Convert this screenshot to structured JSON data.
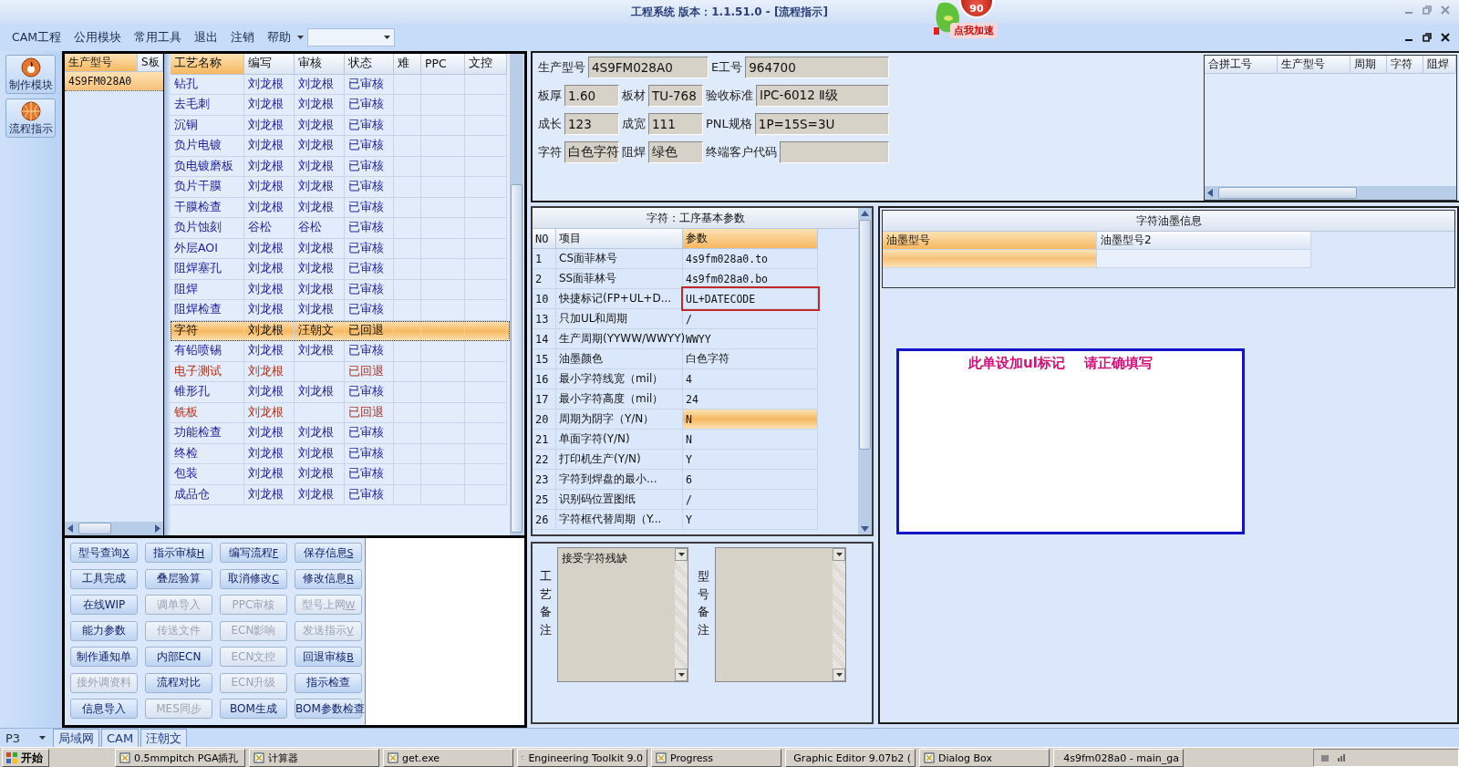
{
  "window": {
    "title": "工程系统   版本：1.1.51.0 - [流程指示]"
  },
  "speed_badge": {
    "value": "90",
    "label": "点我加速"
  },
  "menu": [
    "CAM工程",
    "公用模块",
    "常用工具",
    "退出",
    "注销",
    "帮助"
  ],
  "nav_buttons": [
    "制作模块",
    "流程指示"
  ],
  "model_list": {
    "columns": [
      "生产型号",
      "S板"
    ],
    "rows": [
      {
        "model": "4S9FM028A0",
        "selected": true
      }
    ]
  },
  "process_table": {
    "columns": [
      "工艺名称",
      "编写",
      "审核",
      "状态",
      "难",
      "PPC",
      "文控"
    ],
    "rows": [
      {
        "cells": [
          "钻孔",
          "刘龙根",
          "刘龙根",
          "已审核"
        ],
        "alert": false,
        "selected": false
      },
      {
        "cells": [
          "去毛刺",
          "刘龙根",
          "刘龙根",
          "已审核"
        ],
        "alert": false,
        "selected": false
      },
      {
        "cells": [
          "沉铜",
          "刘龙根",
          "刘龙根",
          "已审核"
        ],
        "alert": false,
        "selected": false
      },
      {
        "cells": [
          "负片电镀",
          "刘龙根",
          "刘龙根",
          "已审核"
        ],
        "alert": false,
        "selected": false
      },
      {
        "cells": [
          "负电镀磨板",
          "刘龙根",
          "刘龙根",
          "已审核"
        ],
        "alert": false,
        "selected": false
      },
      {
        "cells": [
          "负片干膜",
          "刘龙根",
          "刘龙根",
          "已审核"
        ],
        "alert": false,
        "selected": false
      },
      {
        "cells": [
          "干膜检查",
          "刘龙根",
          "刘龙根",
          "已审核"
        ],
        "alert": false,
        "selected": false
      },
      {
        "cells": [
          "负片蚀刻",
          "谷松",
          "谷松",
          "已审核"
        ],
        "alert": false,
        "selected": false
      },
      {
        "cells": [
          "外层AOI",
          "刘龙根",
          "刘龙根",
          "已审核"
        ],
        "alert": false,
        "selected": false
      },
      {
        "cells": [
          "阻焊塞孔",
          "刘龙根",
          "刘龙根",
          "已审核"
        ],
        "alert": false,
        "selected": false
      },
      {
        "cells": [
          "阻焊",
          "刘龙根",
          "刘龙根",
          "已审核"
        ],
        "alert": false,
        "selected": false
      },
      {
        "cells": [
          "阻焊检查",
          "刘龙根",
          "刘龙根",
          "已审核"
        ],
        "alert": false,
        "selected": false
      },
      {
        "cells": [
          "字符",
          "刘龙根",
          "汪朝文",
          "已回退"
        ],
        "alert": false,
        "selected": true
      },
      {
        "cells": [
          "有铅喷锡",
          "刘龙根",
          "刘龙根",
          "已审核"
        ],
        "alert": false,
        "selected": false
      },
      {
        "cells": [
          "电子测试",
          "刘龙根",
          "",
          "已回退"
        ],
        "alert": true,
        "selected": false
      },
      {
        "cells": [
          "锥形孔",
          "刘龙根",
          "刘龙根",
          "已审核"
        ],
        "alert": false,
        "selected": false
      },
      {
        "cells": [
          "铣板",
          "刘龙根",
          "",
          "已回退"
        ],
        "alert": true,
        "selected": false
      },
      {
        "cells": [
          "功能检查",
          "刘龙根",
          "刘龙根",
          "已审核"
        ],
        "alert": false,
        "selected": false
      },
      {
        "cells": [
          "终检",
          "刘龙根",
          "刘龙根",
          "已审核"
        ],
        "alert": false,
        "selected": false
      },
      {
        "cells": [
          "包装",
          "刘龙根",
          "刘龙根",
          "已审核"
        ],
        "alert": false,
        "selected": false
      },
      {
        "cells": [
          "成品仓",
          "刘龙根",
          "刘龙根",
          "已审核"
        ],
        "alert": false,
        "selected": false
      }
    ]
  },
  "actions": [
    {
      "label": "型号查询",
      "hotkey": "X",
      "disabled": false
    },
    {
      "label": "指示审核",
      "hotkey": "H",
      "disabled": false
    },
    {
      "label": "编写流程",
      "hotkey": "F",
      "disabled": false
    },
    {
      "label": "保存信息",
      "hotkey": "S",
      "disabled": false
    },
    {
      "label": "工具完成",
      "disabled": false
    },
    {
      "label": "叠层验算",
      "disabled": false
    },
    {
      "label": "取消修改",
      "hotkey": "C",
      "disabled": false
    },
    {
      "label": "修改信息",
      "hotkey": "R",
      "disabled": false
    },
    {
      "label": "在线WIP",
      "disabled": false
    },
    {
      "label": "调单导入",
      "disabled": true
    },
    {
      "label": "PPC审核",
      "disabled": true
    },
    {
      "label": "型号上网",
      "hotkey": "W",
      "disabled": true
    },
    {
      "label": "能力参数",
      "disabled": false
    },
    {
      "label": "传送文件",
      "disabled": true
    },
    {
      "label": "ECN影响",
      "disabled": true
    },
    {
      "label": "发送指示",
      "hotkey": "V",
      "disabled": true
    },
    {
      "label": "制作通知单",
      "disabled": false
    },
    {
      "label": "内部ECN",
      "disabled": false
    },
    {
      "label": "ECN文控",
      "disabled": true
    },
    {
      "label": "回退审核",
      "hotkey": "B",
      "disabled": false
    },
    {
      "label": "接外调资料",
      "disabled": true
    },
    {
      "label": "流程对比",
      "disabled": false
    },
    {
      "label": "ECN升级",
      "disabled": true
    },
    {
      "label": "指示检查",
      "disabled": false
    },
    {
      "label": "信息导入",
      "disabled": false
    },
    {
      "label": "MES同步",
      "disabled": true
    },
    {
      "label": "BOM生成",
      "disabled": false
    },
    {
      "label": "BOM参数检查",
      "disabled": false
    }
  ],
  "info_fields": [
    [
      {
        "label": "生产型号",
        "value": "4S9FM028A0"
      },
      {
        "label": "E工号",
        "value": "964700"
      }
    ],
    [
      {
        "label": "板厚",
        "value": "1.60"
      },
      {
        "label": "板材",
        "value": "TU-768"
      },
      {
        "label": "验收标准",
        "value": "IPC-6012 Ⅱ级"
      }
    ],
    [
      {
        "label": "成长",
        "value": "123"
      },
      {
        "label": "成宽",
        "value": "111"
      },
      {
        "label": "PNL规格",
        "value": "1P=15S=3U"
      }
    ],
    [
      {
        "label": "字符",
        "value": "白色字符"
      },
      {
        "label": "阻焊",
        "value": "绿色"
      },
      {
        "label": "终端客户代码"
      }
    ]
  ],
  "batch_table": {
    "columns": [
      "合拼工号",
      "生产型号",
      "周期",
      "字符",
      "阻焊"
    ]
  },
  "params": {
    "title": "字符：工序基本参数",
    "columns": [
      "NO",
      "项目",
      "参数"
    ],
    "rows": [
      {
        "no": "1",
        "item": "CS面菲林号",
        "value": "4s9fm028a0.to",
        "selected": false,
        "marked": false
      },
      {
        "no": "2",
        "item": "SS面菲林号",
        "value": "4s9fm028a0.bo",
        "selected": false,
        "marked": false
      },
      {
        "no": "10",
        "item": "快捷标记(FP+UL+D...",
        "value": "UL+DATECODE",
        "selected": false,
        "marked": true
      },
      {
        "no": "13",
        "item": "只加UL和周期",
        "value": "/",
        "selected": false,
        "marked": false
      },
      {
        "no": "14",
        "item": "生产周期(YYWW/WWYY)",
        "value": "WWYY",
        "selected": false,
        "marked": false
      },
      {
        "no": "15",
        "item": "油墨颜色",
        "value": "白色字符",
        "selected": false,
        "marked": false
      },
      {
        "no": "16",
        "item": "最小字符线宽（mil）",
        "value": "4",
        "selected": false,
        "marked": false
      },
      {
        "no": "17",
        "item": "最小字符高度（mil）",
        "value": "24",
        "selected": false,
        "marked": false
      },
      {
        "no": "20",
        "item": "周期为阴字（Y/N）",
        "value": "N",
        "selected": true,
        "marked": false
      },
      {
        "no": "21",
        "item": "单面字符(Y/N)",
        "value": "N",
        "selected": false,
        "marked": false
      },
      {
        "no": "22",
        "item": "打印机生产(Y/N)",
        "value": "Y",
        "selected": false,
        "marked": false
      },
      {
        "no": "23",
        "item": "字符到焊盘的最小...",
        "value": "6",
        "selected": false,
        "marked": false
      },
      {
        "no": "25",
        "item": "识别码位置图纸",
        "value": "/",
        "selected": false,
        "marked": false
      },
      {
        "no": "26",
        "item": "字符框代替周期（Y...",
        "value": "Y",
        "selected": false,
        "marked": false
      }
    ]
  },
  "remarks": [
    {
      "label": "工艺备注",
      "text": "接受字符残缺"
    },
    {
      "label": "型号备注"
    }
  ],
  "ink": {
    "title": "字符油墨信息",
    "columns": [
      "油墨型号",
      "油墨型号2"
    ]
  },
  "note": "此单设加ul标记    请正确填写",
  "bottom_tabs": {
    "selector": "P3",
    "tabs": [
      "局域网",
      "CAM",
      "汪朝文"
    ]
  },
  "taskbar": {
    "start": "开始",
    "tasks": [
      "0.5mmpitch PGA插孔",
      "计算器",
      "get.exe",
      "Engineering Toolkit 9.0",
      "Progress",
      "Graphic Editor 9.07b2 (",
      "Dialog Box",
      "4s9fm028a0 - main_ga"
    ]
  }
}
